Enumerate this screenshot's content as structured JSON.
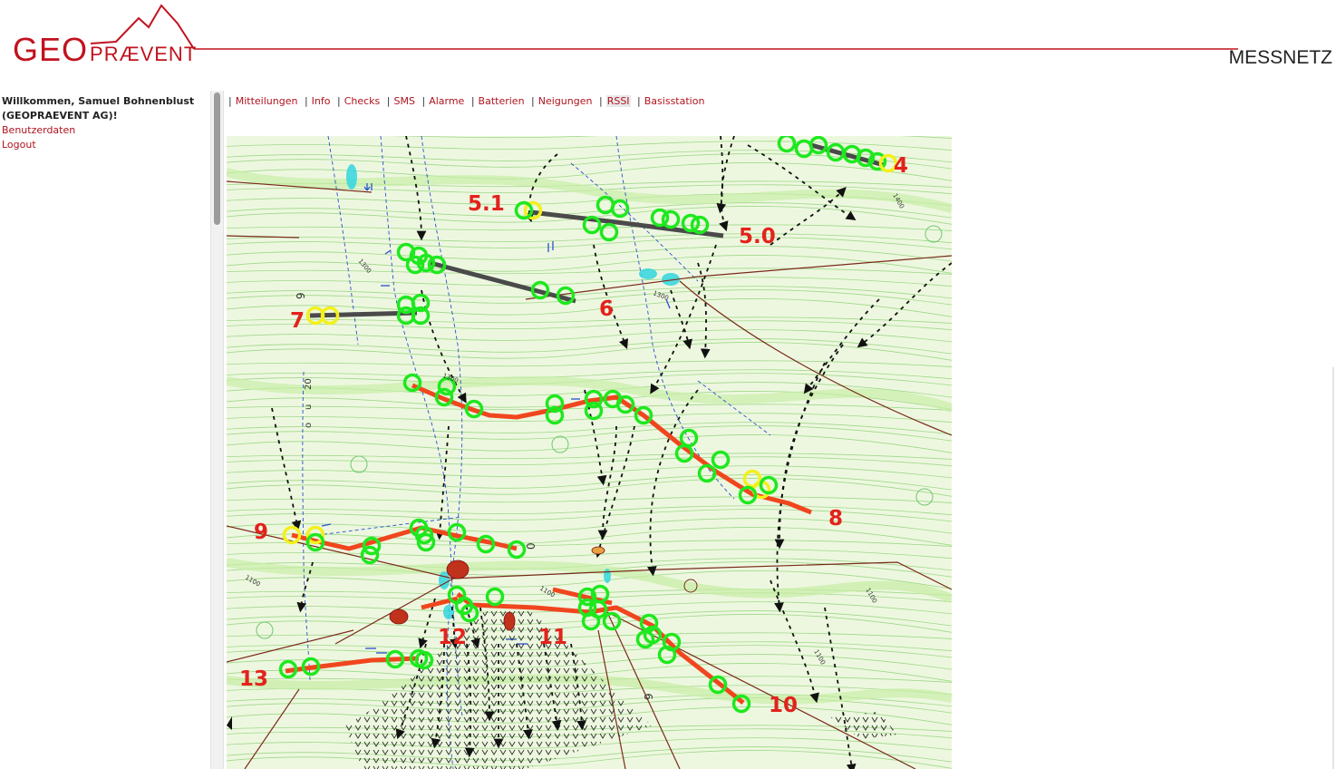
{
  "header": {
    "logo_geo": "GEO",
    "logo_praevent": "PRÆVENT",
    "section": "MESSNETZ",
    "brand_color": "#c1121f"
  },
  "sidebar": {
    "welcome_line1": "Willkommen, Samuel Bohnenblust",
    "welcome_line2": "(GEOPRAEVENT AG)!",
    "links": [
      "Benutzerdaten",
      "Logout"
    ]
  },
  "nav": {
    "items": [
      "Mitteilungen",
      "Info",
      "Checks",
      "SMS",
      "Alarme",
      "Batterien",
      "Neigungen",
      "RSSI",
      "Basisstation"
    ],
    "active": "RSSI"
  },
  "map": {
    "line_labels": [
      "4",
      "5.1",
      "5.0",
      "6",
      "7",
      "8",
      "9",
      "10",
      "11",
      "12",
      "13"
    ],
    "contour_labels": [
      "1400",
      "1300",
      "1300",
      "1300",
      "1100",
      "1100",
      "1100",
      "1100"
    ],
    "misc_labels": [
      "20",
      "u",
      "o",
      "9",
      "0",
      "9"
    ],
    "colors": {
      "ok": "#1ee81e",
      "warn": "#f3f01a",
      "line_active": "#f0461e",
      "line_inactive": "#4a4a4a",
      "label": "#e3221c",
      "terrain": "#eaf6d9"
    }
  }
}
